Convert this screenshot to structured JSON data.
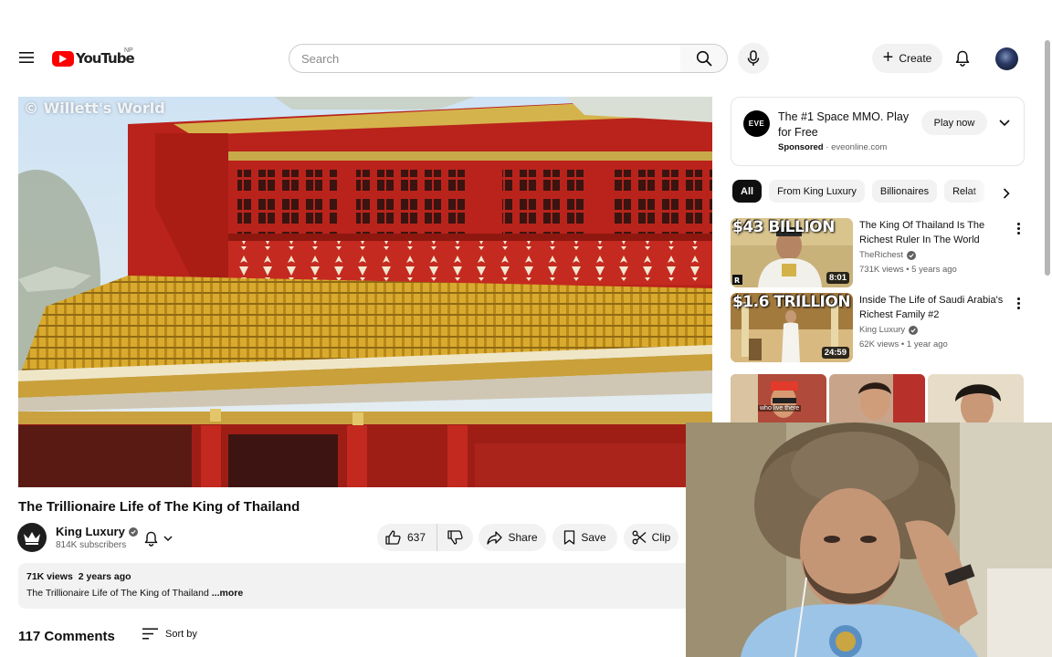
{
  "header": {
    "logo_text": "YouTube",
    "country_code": "NP",
    "search_placeholder": "Search",
    "create_label": "Create"
  },
  "player": {
    "watermark": "© Willett's World"
  },
  "video": {
    "title": "The Trillionaire Life of The King of Thailand",
    "channel_name": "King Luxury",
    "subscribers": "814K subscribers",
    "likes": "637",
    "share_label": "Share",
    "save_label": "Save",
    "clip_label": "Clip",
    "views": "71K views",
    "age": "2 years ago",
    "description": "The Trillionaire Life of The King of Thailand",
    "more_label": "...more",
    "comments_count": "117 Comments",
    "sort_label": "Sort by"
  },
  "ad": {
    "logo_text": "EVE",
    "title": "The #1 Space MMO. Play for Free",
    "sponsored_label": "Sponsored",
    "domain": "eveonline.com",
    "cta_label": "Play now"
  },
  "chips": [
    "All",
    "From King Luxury",
    "Billionaires",
    "Relat"
  ],
  "recommendations": [
    {
      "title": "The King Of Thailand Is The Richest Ruler In The World",
      "channel": "TheRichest",
      "stats": "731K views • 5 years ago",
      "duration": "8:01",
      "thumb_text": "$43 BILLION"
    },
    {
      "title": "Inside The Life of Saudi Arabia's Richest Family #2",
      "channel": "King Luxury",
      "stats": "62K views • 1 year ago",
      "duration": "24:59",
      "thumb_text": "$1.6 TRILLION"
    }
  ],
  "shorts": {
    "caption": "who live there"
  },
  "colors": {
    "brand_red": "#ff0000",
    "chip_active": "#0f0f0f",
    "surface": "#f2f2f2",
    "secondary_text": "#606060"
  },
  "icons": [
    "menu-icon",
    "search-icon",
    "mic-icon",
    "plus-icon",
    "bell-icon",
    "verified-icon",
    "like-icon",
    "dislike-icon",
    "share-icon",
    "save-icon",
    "clip-icon",
    "sort-icon",
    "chevron-down-icon",
    "chevron-right-icon",
    "more-vert-icon"
  ]
}
